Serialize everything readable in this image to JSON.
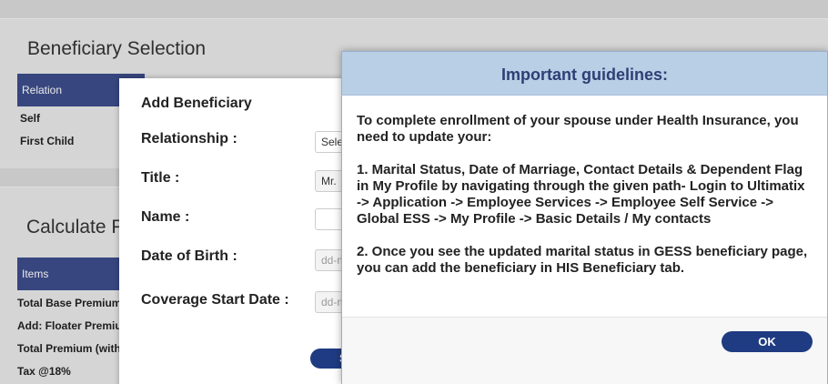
{
  "background": {
    "beneficiary": {
      "title": "Beneficiary Selection",
      "table_header": "Relation",
      "rows": [
        "Self",
        "First Child"
      ]
    },
    "calculate": {
      "title": "Calculate P",
      "table_header": "Items",
      "rows": [
        "Total Base Premium",
        "Add: Floater Premium",
        "Total Premium (with",
        "Tax @18%"
      ]
    }
  },
  "add_dialog": {
    "title": "Add Beneficiary",
    "relationship_label": "Relationship :",
    "relationship_value": "Sele",
    "title_label": "Title :",
    "title_value": "Mr.",
    "name_label": "Name :",
    "name_value": "",
    "dob_label": "Date of Birth :",
    "dob_placeholder": "dd-m",
    "coverage_label": "Coverage Start Date :",
    "coverage_placeholder": "dd-m",
    "submit_label": "S",
    "ok_label": "Ok"
  },
  "guidelines": {
    "title": "Important guidelines:",
    "paragraphs": [
      "To complete enrollment of your spouse under Health Insurance, you need to update your:",
      "1. Marital Status, Date of Marriage, Contact Details & Dependent Flag in My Profile by navigating through the given path- Login to Ultimatix -> Application -> Employee Services -> Employee Self Service -> Global ESS -> My Profile -> Basic Details / My contacts",
      "2. Once you see the updated marital status in GESS beneficiary page, you can add the beneficiary in HIS Beneficiary tab."
    ],
    "ok_label": "OK"
  }
}
